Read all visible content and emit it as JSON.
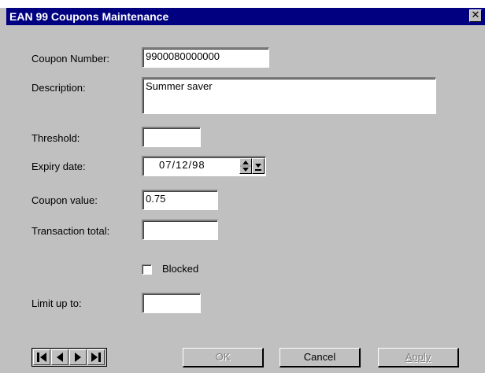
{
  "window": {
    "title": "EAN 99 Coupons Maintenance",
    "close_glyph": "✕"
  },
  "form": {
    "coupon_number": {
      "label": "Coupon Number:",
      "value": "9900080000000"
    },
    "description": {
      "label": "Description:",
      "value": "Summer saver"
    },
    "threshold": {
      "label": "Threshold:",
      "value": ""
    },
    "expiry_date": {
      "label": "Expiry date:",
      "value": "07/12/98"
    },
    "coupon_value": {
      "label": "Coupon value:",
      "value": "0.75"
    },
    "transaction_total": {
      "label": "Transaction total:",
      "value": ""
    },
    "blocked": {
      "label": "Blocked",
      "checked": false
    },
    "limit_up_to": {
      "label": "Limit up to:",
      "value": ""
    }
  },
  "navigation": {
    "first_icon": "first-record-icon",
    "prev_icon": "previous-record-icon",
    "next_icon": "next-record-icon",
    "last_icon": "last-record-icon"
  },
  "buttons": {
    "ok": "OK",
    "cancel": "Cancel",
    "apply": "Apply"
  }
}
